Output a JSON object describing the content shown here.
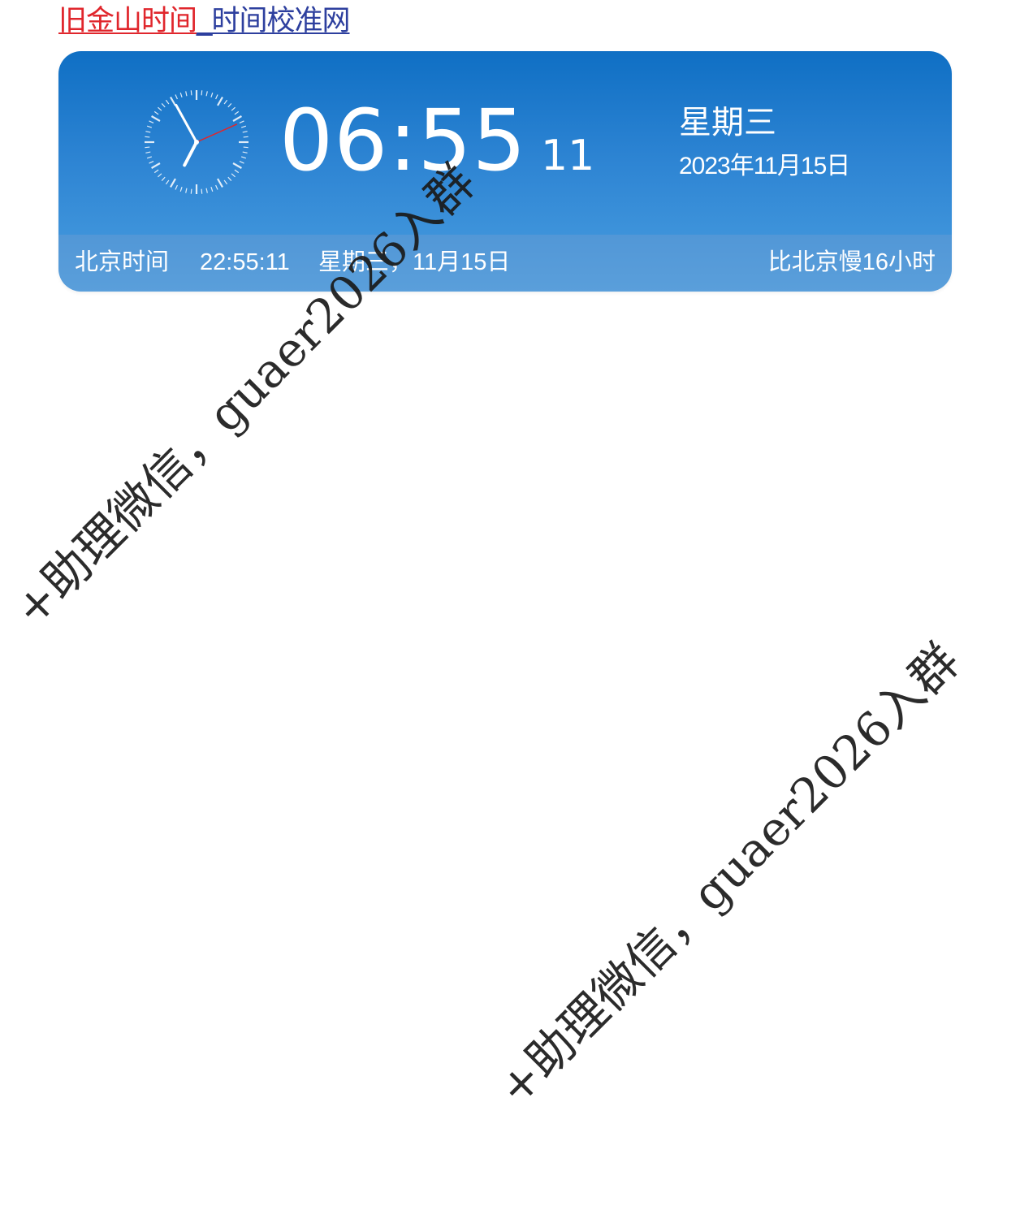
{
  "header": {
    "city_link": "旧金山时间",
    "separator": "_",
    "site_link": "时间校准网"
  },
  "clock": {
    "local_time_hm": "06:55",
    "local_seconds": "11",
    "weekday": "星期三",
    "full_date": "2023年11月15日",
    "analog": {
      "hour": 6,
      "minute": 55,
      "second": 11
    }
  },
  "beijing": {
    "label": "北京时间",
    "time": "22:55:11",
    "date": "星期三，11月15日",
    "offset_text": "比北京慢16小时"
  },
  "watermark": {
    "text": "+助理微信，guaer2026入群"
  },
  "colors": {
    "card_top": "#0f6fc4",
    "card_bottom": "#4a9ee0",
    "city_link": "#e0262c",
    "site_link": "#2d3f9e",
    "second_hand": "#e0262c"
  }
}
